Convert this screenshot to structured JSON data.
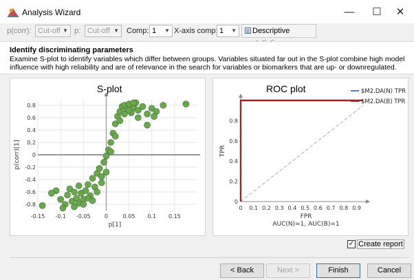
{
  "window": {
    "title": "Analysis Wizard",
    "minimize_label": "—",
    "maximize_label": "☐",
    "close_label": "✕"
  },
  "toolbar": {
    "pcorr_label": "p(corr):",
    "pcorr_value": "Cut-off",
    "p_label": "p:",
    "p_value": "Cut-off",
    "comp_label": "Comp:",
    "comp_value": "1",
    "xaxis_label": "X-axis comp:",
    "xaxis_value": "1",
    "descriptive_label": "Descriptive statistics"
  },
  "header": {
    "title": "Identify discriminating parameters",
    "description": "Examine S-plot to identify variables which differ between groups. Variables situated far out in the S-plot combine high model influence with high reliability and are of relevance in the search for variables or biomarkers that are up- or downregulated."
  },
  "splot": {
    "title": "S-plot",
    "xlabel": "p[1]",
    "ylabel": "p(corr)[1]",
    "point_color": "#6aa84f"
  },
  "roc": {
    "title": "ROC plot",
    "xlabel": "FPR",
    "ylabel": "TPR",
    "auc_text": "AUC(N)=1, AUC(B)=1",
    "legend_n": "$M2.DA(N) TPR",
    "legend_b": "$M2.DA(B) TPR",
    "color_n": "#4a7ebb",
    "color_b": "#a12020"
  },
  "chart_data": [
    {
      "type": "scatter",
      "title": "S-plot",
      "xlabel": "p[1]",
      "ylabel": "p(corr)[1]",
      "xlim": [
        -0.15,
        0.2
      ],
      "ylim": [
        -0.9,
        0.9
      ],
      "xticks": [
        "-0.15",
        "-0.1",
        "-0.05",
        "0",
        "0.05",
        "0.1",
        "0.15"
      ],
      "yticks": [
        "0.8",
        "0.6",
        "0.4",
        "0.2",
        "0",
        "-0.2",
        "-0.4",
        "-0.6",
        "-0.8"
      ],
      "series": [
        {
          "x": [
            -0.14,
            -0.11,
            -0.1,
            -0.09,
            -0.085,
            -0.08,
            -0.075,
            -0.07,
            -0.065,
            -0.06,
            -0.055,
            -0.05,
            -0.045,
            -0.04,
            -0.035,
            -0.03,
            -0.025,
            -0.02,
            -0.015,
            -0.01,
            -0.005,
            0.0,
            0.005,
            0.01,
            0.015,
            0.02,
            0.025,
            0.03,
            0.035,
            0.04,
            0.045,
            0.05,
            0.055,
            0.06,
            0.065,
            0.07,
            0.08,
            0.09,
            0.1,
            0.11,
            0.125,
            0.175,
            -0.12,
            -0.095,
            -0.07,
            -0.06,
            -0.05,
            -0.04,
            -0.03,
            -0.02,
            -0.01,
            0.0,
            0.01,
            0.02,
            0.03,
            0.04,
            0.05,
            0.06,
            0.07,
            0.09,
            0.105
          ],
          "y": [
            -0.82,
            -0.58,
            -0.72,
            -0.8,
            -0.65,
            -0.55,
            -0.75,
            -0.6,
            -0.7,
            -0.5,
            -0.62,
            -0.72,
            -0.58,
            -0.48,
            -0.66,
            -0.38,
            -0.52,
            -0.3,
            -0.22,
            -0.35,
            -0.12,
            -0.02,
            0.08,
            0.2,
            0.35,
            0.5,
            0.62,
            0.7,
            0.78,
            0.8,
            0.74,
            0.82,
            0.68,
            0.76,
            0.84,
            0.72,
            0.78,
            0.66,
            0.75,
            0.7,
            0.8,
            0.82,
            -0.62,
            -0.86,
            -0.84,
            -0.78,
            -0.8,
            -0.7,
            -0.74,
            -0.6,
            -0.45,
            -0.28,
            0.05,
            0.3,
            0.55,
            0.66,
            0.72,
            0.84,
            0.6,
            0.48,
            0.62
          ]
        }
      ]
    },
    {
      "type": "line",
      "title": "ROC plot",
      "xlabel": "FPR",
      "ylabel": "TPR",
      "xlim": [
        0,
        0.95
      ],
      "ylim": [
        0,
        1
      ],
      "xticks": [
        "0",
        "0.1",
        "0.2",
        "0.3",
        "0.4",
        "0.5",
        "0.6",
        "0.7",
        "0.8",
        "0.9"
      ],
      "yticks": [
        "0",
        "0.2",
        "0.4",
        "0.6",
        "0.8"
      ],
      "annotation": "AUC(N)=1, AUC(B)=1",
      "series": [
        {
          "name": "$M2.DA(N) TPR",
          "x": [
            0,
            0,
            0.95
          ],
          "y": [
            0,
            1,
            1
          ]
        },
        {
          "name": "$M2.DA(B) TPR",
          "x": [
            0,
            0,
            0.95
          ],
          "y": [
            0,
            1,
            1
          ]
        }
      ]
    }
  ],
  "footer": {
    "create_report_label": "Create report",
    "create_report_checked": "✓",
    "back_label": "< Back",
    "next_label": "Next >",
    "finish_label": "Finish",
    "cancel_label": "Cancel"
  }
}
